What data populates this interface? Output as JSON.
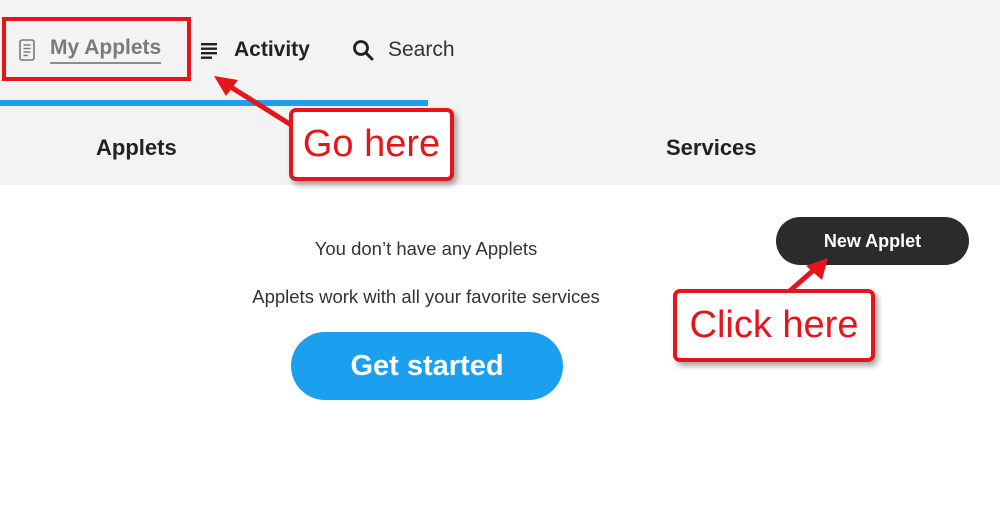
{
  "nav": {
    "my_applets": {
      "label": "My Applets",
      "icon": "document-icon"
    },
    "activity": {
      "label": "Activity",
      "icon": "list-icon"
    },
    "search": {
      "label": "Search",
      "icon": "search-icon"
    }
  },
  "tabs": [
    {
      "label": "Applets",
      "active": true
    },
    {
      "label": "Services",
      "active": false
    }
  ],
  "empty_state": {
    "line1": "You don’t have any Applets",
    "line2": "Applets work with all your favorite services",
    "cta_label": "Get started"
  },
  "new_applet_label": "New Applet",
  "annotations": {
    "go_here": "Go here",
    "click_here": "Click here"
  },
  "colors": {
    "accent_blue": "#1aa0ef",
    "annotation_red": "#e6141b",
    "dark_button": "#2b2b2b"
  }
}
